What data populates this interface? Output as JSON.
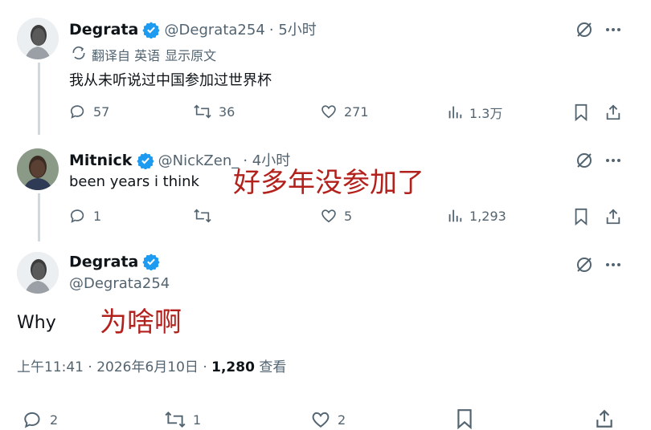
{
  "tweet1": {
    "name": "Degrata",
    "handle": "@Degrata254",
    "time": "· 5小时",
    "translated_from": "翻译自 英语",
    "show_original": "显示原文",
    "text": "我从未听说过中国参加过世界杯",
    "replies": "57",
    "retweets": "36",
    "likes": "271",
    "views": "1.3万"
  },
  "tweet2": {
    "name": "Mitnick",
    "handle": "@NickZen_",
    "time": "· 4小时",
    "text": "been years i think",
    "overlay": "好多年没参加了",
    "replies": "1",
    "likes": "5",
    "views": "1,293"
  },
  "tweet3": {
    "name": "Degrata",
    "handle": "@Degrata254",
    "text": "Why",
    "overlay": "为啥啊",
    "timestamp": "上午11:41 · 2026年6月10日 · ",
    "views_count": "1,280",
    "views_label": "查看",
    "replies": "2",
    "retweets": "1",
    "likes": "2"
  },
  "colors": {
    "verified_blue": "#1d9bf0",
    "secondary_text": "#536471",
    "overlay_red": "#b3211c"
  }
}
